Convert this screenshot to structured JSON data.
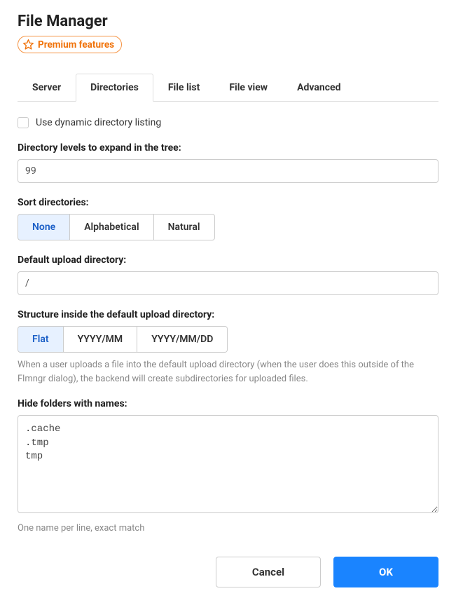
{
  "header": {
    "title": "File Manager",
    "premium_label": "Premium features"
  },
  "tabs": {
    "server": "Server",
    "directories": "Directories",
    "file_list": "File list",
    "file_view": "File view",
    "advanced": "Advanced"
  },
  "form": {
    "dynamic_listing_label": "Use dynamic directory listing",
    "expand_levels_label": "Directory levels to expand in the tree:",
    "expand_levels_value": "99",
    "sort_label": "Sort directories:",
    "sort_options": {
      "none": "None",
      "alpha": "Alphabetical",
      "natural": "Natural"
    },
    "default_upload_label": "Default upload directory:",
    "default_upload_value": "/",
    "structure_label": "Structure inside the default upload directory:",
    "structure_options": {
      "flat": "Flat",
      "yyyymm": "YYYY/MM",
      "yyyymmdd": "YYYY/MM/DD"
    },
    "structure_help": "When a user uploads a file into the default upload directory (when the user does this outside of the Flmngr dialog), the backend will create subdirectories for uploaded files.",
    "hide_folders_label": "Hide folders with names:",
    "hide_folders_value": ".cache\n.tmp\ntmp",
    "hide_folders_help": "One name per line, exact match"
  },
  "buttons": {
    "cancel": "Cancel",
    "ok": "OK"
  }
}
